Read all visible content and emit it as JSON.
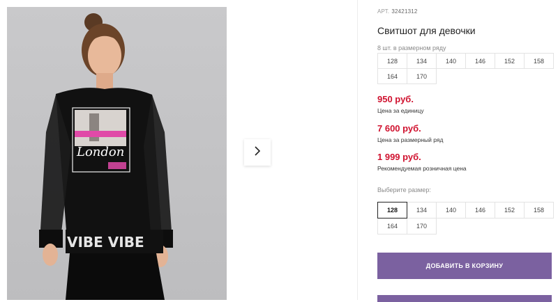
{
  "product": {
    "sku_prefix": "АРТ.",
    "sku": "32421312",
    "title": "Свитшот для девочки",
    "image": {
      "alt": "Девочка в черном свитшоте с принтом London и надписью VIBE",
      "print_text": "London",
      "hem_text": "VIBE VIBE VIBE"
    }
  },
  "row_info": {
    "caption": "8 шт. в размерном ряду",
    "sizes": [
      "128",
      "134",
      "140",
      "146",
      "152",
      "158",
      "164",
      "170"
    ]
  },
  "prices": [
    {
      "amount": "950 руб.",
      "label": "Цена за единицу"
    },
    {
      "amount": "7 600 руб.",
      "label": "Цена за размерный ряд"
    },
    {
      "amount": "1 999 руб.",
      "label": "Рекомендуемая розничная цена"
    }
  ],
  "size_selector": {
    "caption": "Выберите размер:",
    "selected": "128",
    "sizes": [
      "128",
      "134",
      "140",
      "146",
      "152",
      "158",
      "164",
      "170"
    ]
  },
  "buttons": {
    "add_to_cart": "ДОБАВИТЬ В КОРЗИНУ"
  },
  "icons": {
    "next": "chevron-right-icon"
  },
  "colors": {
    "price": "#d0122f",
    "button": "#7b61a0"
  }
}
